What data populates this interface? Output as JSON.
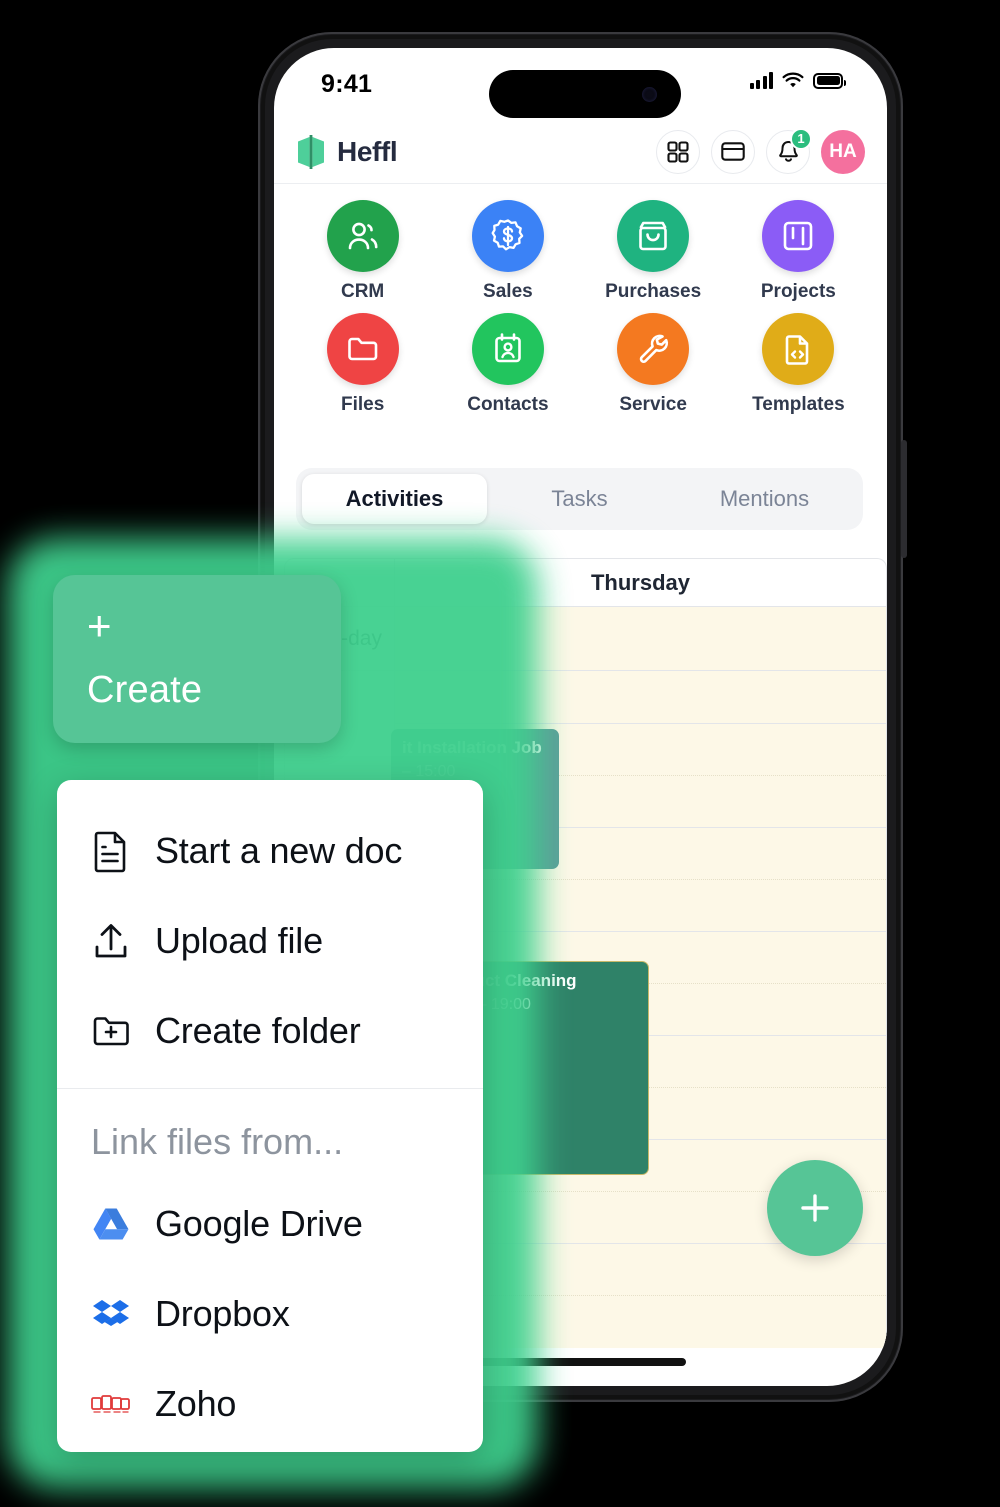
{
  "status_bar": {
    "time": "9:41",
    "signal_icon": "cellular-signal-icon",
    "wifi_icon": "wifi-icon",
    "battery_icon": "battery-icon"
  },
  "header": {
    "logo_icon": "heffl-logo-icon",
    "brand": "Heffl",
    "apps_grid_icon": "apps-grid-icon",
    "billing_icon": "credit-card-icon",
    "notifications_icon": "bell-icon",
    "notification_count": "1",
    "avatar_initials": "HA"
  },
  "apps": [
    {
      "label": "CRM",
      "icon": "users-icon",
      "color": "#22a24c"
    },
    {
      "label": "Sales",
      "icon": "dollar-badge-icon",
      "color": "#3b82f6"
    },
    {
      "label": "Purchases",
      "icon": "shopping-bag-icon",
      "color": "#1fb380"
    },
    {
      "label": "Projects",
      "icon": "kanban-board-icon",
      "color": "#8b5cf6"
    },
    {
      "label": "Files",
      "icon": "folder-icon",
      "color": "#ef4444"
    },
    {
      "label": "Contacts",
      "icon": "contact-card-icon",
      "color": "#22c55e"
    },
    {
      "label": "Service",
      "icon": "wrench-icon",
      "color": "#f47920"
    },
    {
      "label": "Templates",
      "icon": "code-file-icon",
      "color": "#e0ac18"
    }
  ],
  "tabs": [
    {
      "label": "Activities",
      "active": true
    },
    {
      "label": "Tasks",
      "active": false
    },
    {
      "label": "Mentions",
      "active": false
    }
  ],
  "calendar": {
    "day_header": "Thursday",
    "allday_label": "all-day",
    "events": [
      {
        "title": "it Installation Job",
        "time": "– 15:00",
        "color": "#5d9e99"
      },
      {
        "title": "AC Duct Cleaning",
        "time": "17:00 – 19:00",
        "color": "#2f8268"
      }
    ],
    "fab_icon": "plus-icon"
  },
  "create_button": {
    "plus_icon": "plus-icon",
    "label": "Create"
  },
  "create_menu": {
    "items": [
      {
        "label": "Start a new doc",
        "icon": "document-icon"
      },
      {
        "label": "Upload file",
        "icon": "upload-icon"
      },
      {
        "label": "Create folder",
        "icon": "folder-plus-icon"
      }
    ],
    "link_section_title": "Link files from...",
    "providers": [
      {
        "label": "Google Drive",
        "icon": "google-drive-icon"
      },
      {
        "label": "Dropbox",
        "icon": "dropbox-icon"
      },
      {
        "label": "Zoho",
        "icon": "zoho-icon"
      }
    ]
  }
}
